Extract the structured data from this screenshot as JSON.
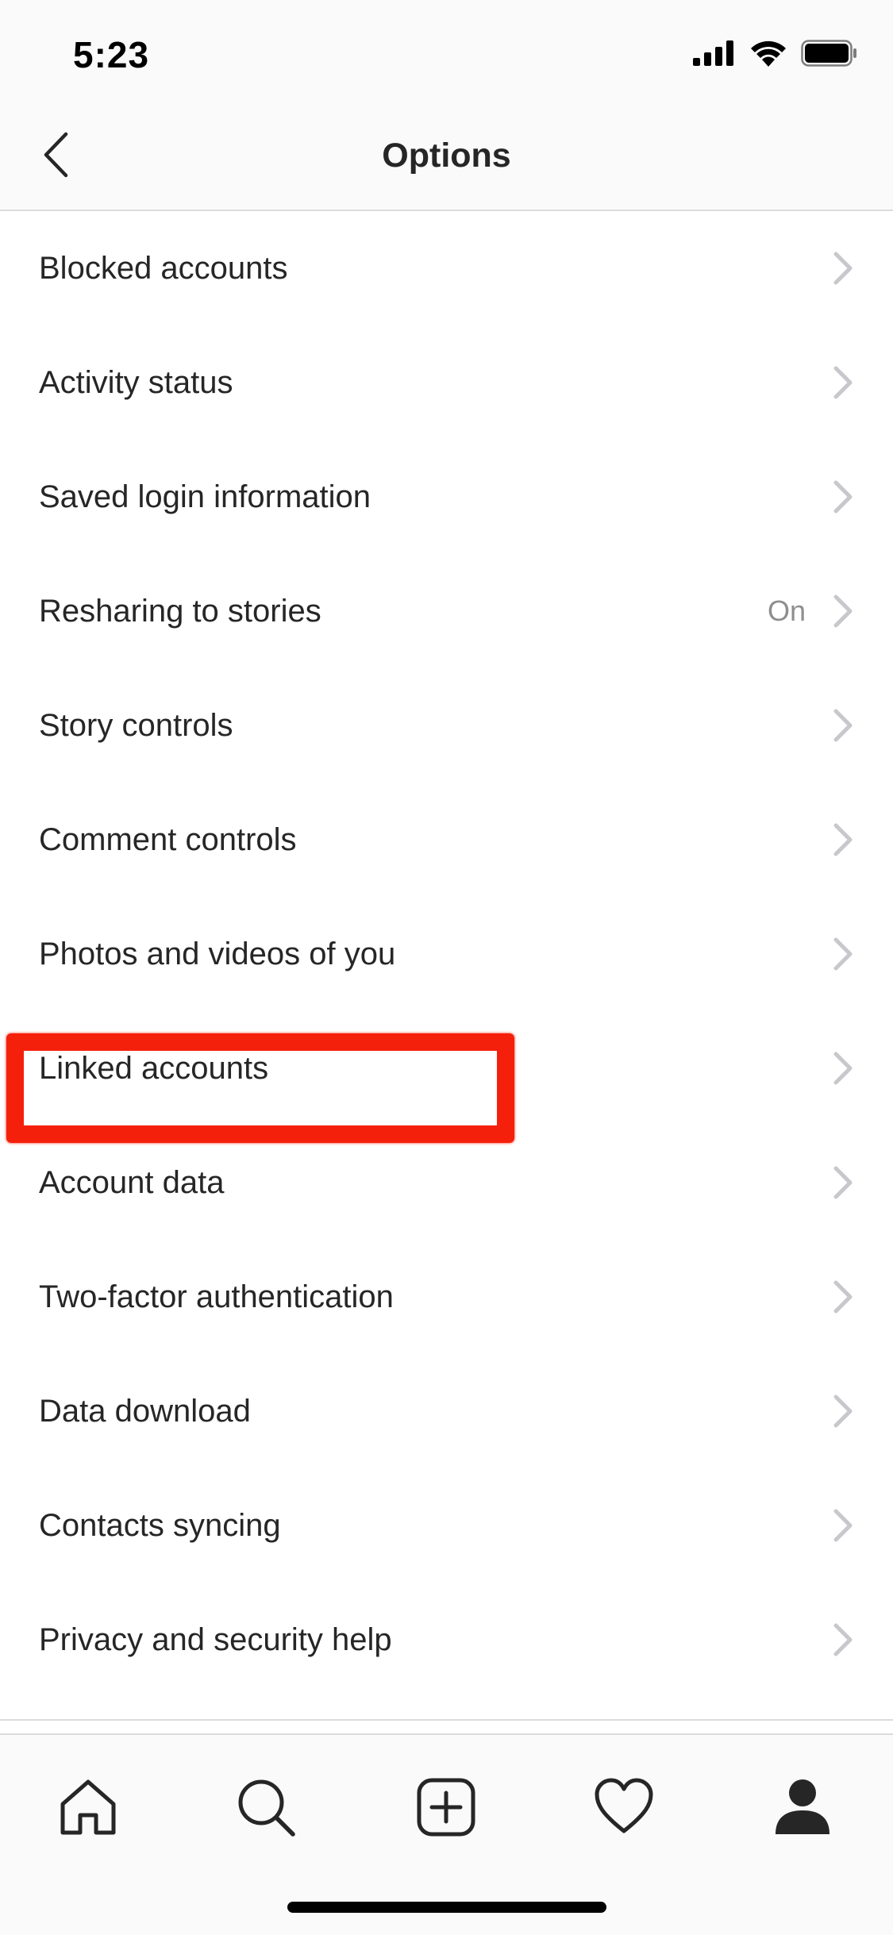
{
  "status_bar": {
    "time": "5:23"
  },
  "header": {
    "title": "Options",
    "back_icon": "chevron-left-icon"
  },
  "options": [
    {
      "label": "Blocked accounts",
      "value": ""
    },
    {
      "label": "Activity status",
      "value": ""
    },
    {
      "label": "Saved login information",
      "value": ""
    },
    {
      "label": "Resharing to stories",
      "value": "On"
    },
    {
      "label": "Story controls",
      "value": ""
    },
    {
      "label": "Comment controls",
      "value": ""
    },
    {
      "label": "Photos and videos of you",
      "value": ""
    },
    {
      "label": "Linked accounts",
      "value": ""
    },
    {
      "label": "Account data",
      "value": ""
    },
    {
      "label": "Two-factor authentication",
      "value": ""
    },
    {
      "label": "Data download",
      "value": ""
    },
    {
      "label": "Contacts syncing",
      "value": ""
    },
    {
      "label": "Privacy and security help",
      "value": ""
    }
  ],
  "tab_bar": {
    "tabs": [
      "home-icon",
      "search-icon",
      "new-post-icon",
      "activity-heart-icon",
      "profile-icon"
    ],
    "active": "profile-icon"
  },
  "colors": {
    "highlight": "#f4200c",
    "text": "#262626",
    "secondary_text": "#8e8e8e",
    "chevron": "#c7c7cc",
    "bar_background": "#fafafa"
  }
}
